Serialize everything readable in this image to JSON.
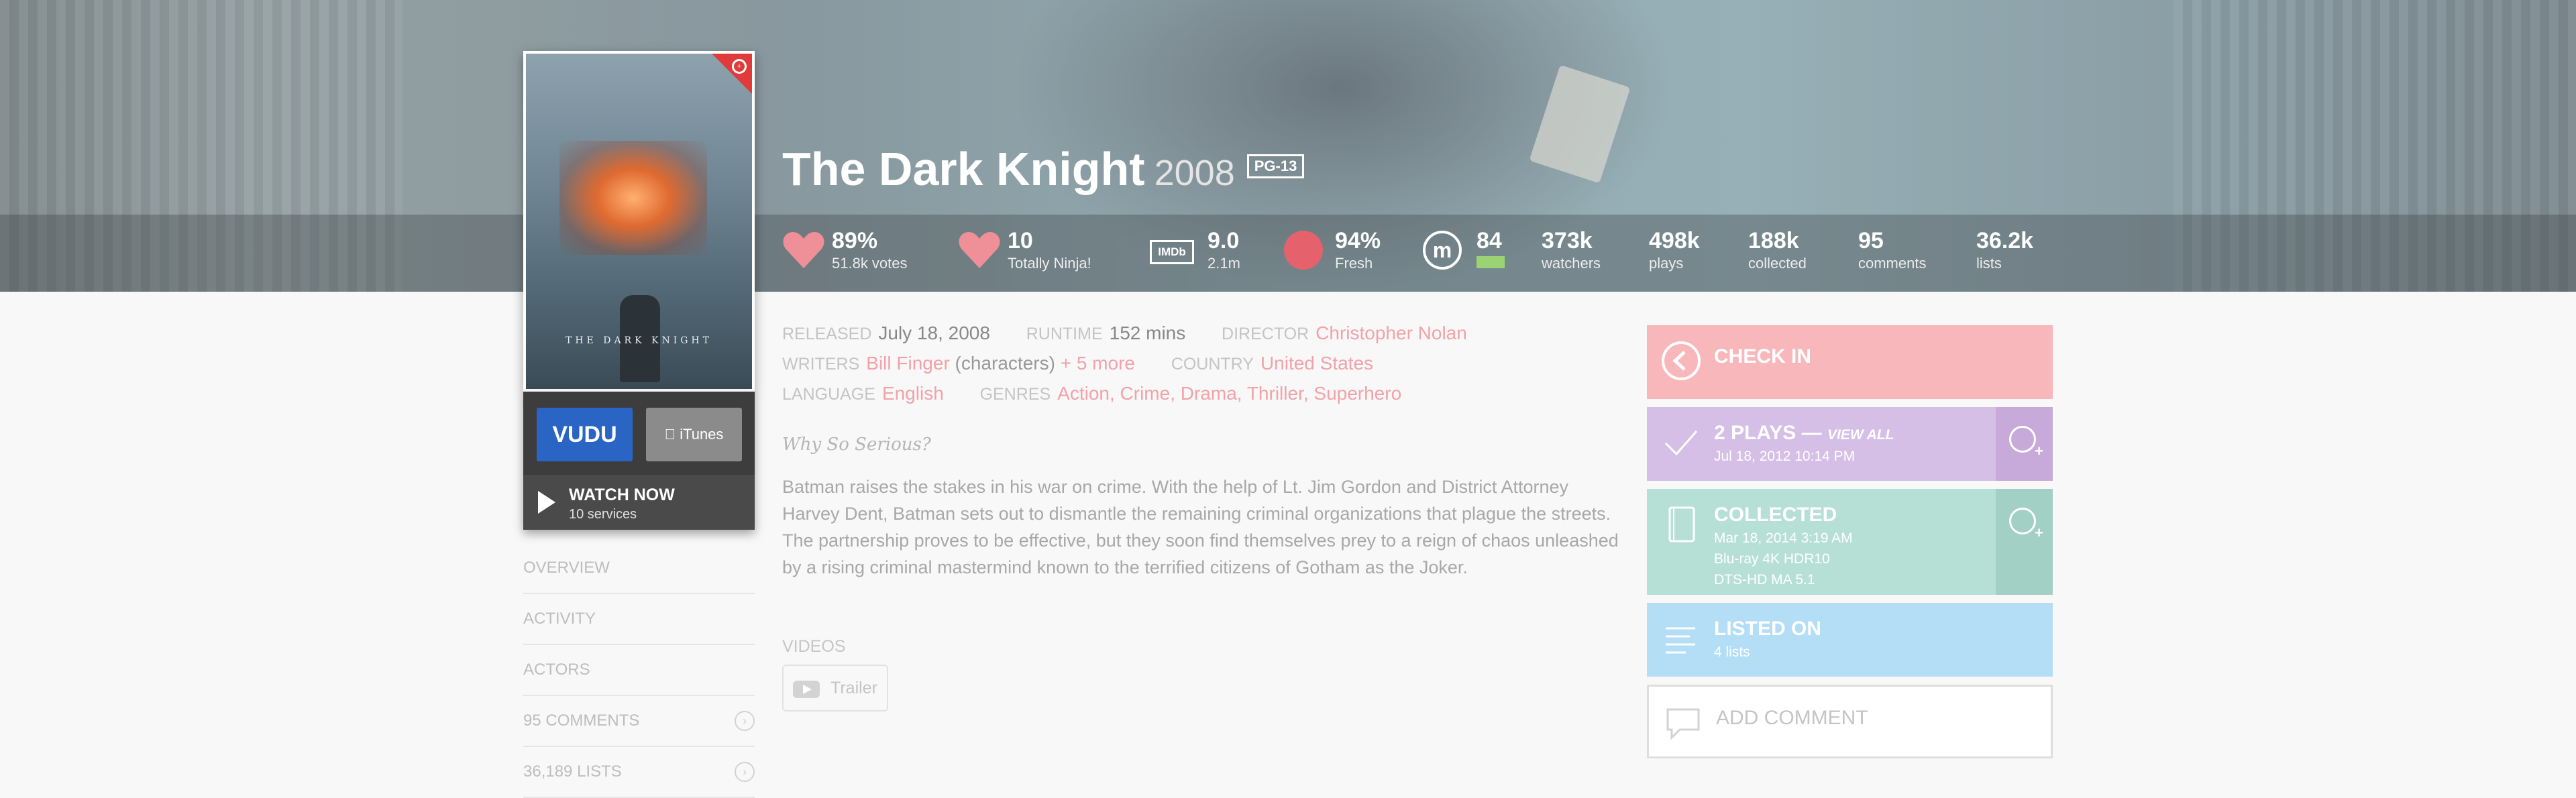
{
  "movie": {
    "title": "The Dark Knight",
    "year": "2008",
    "certification": "PG-13",
    "poster_text": "THE DARK KNIGHT"
  },
  "stats": {
    "trakt_rating": {
      "value": "89%",
      "label": "51.8k votes"
    },
    "user_rating": {
      "value": "10",
      "label": "Totally Ninja!"
    },
    "imdb": {
      "icon": "IMDb",
      "value": "9.0",
      "label": "2.1m"
    },
    "tomatometer": {
      "value": "94%",
      "label": "Fresh"
    },
    "metacritic": {
      "icon": "m",
      "value": "84",
      "color": "#9bd374"
    },
    "watchers": {
      "value": "373k",
      "label": "watchers"
    },
    "plays": {
      "value": "498k",
      "label": "plays"
    },
    "collected": {
      "value": "188k",
      "label": "collected"
    },
    "comments": {
      "value": "95",
      "label": "comments"
    },
    "lists": {
      "value": "36.2k",
      "label": "lists"
    }
  },
  "watch": {
    "vudu_label": "VUDU",
    "itunes_label": "iTunes",
    "watch_now_title": "WATCH NOW",
    "watch_now_sub": "10 services"
  },
  "sidenav": {
    "items": [
      {
        "label": "OVERVIEW"
      },
      {
        "label": "ACTIVITY"
      },
      {
        "label": "ACTORS"
      },
      {
        "label": "95 COMMENTS"
      },
      {
        "label": "36,189 LISTS"
      }
    ]
  },
  "details": {
    "released_key": "RELEASED",
    "released": "July 18, 2008",
    "runtime_key": "RUNTIME",
    "runtime": "152 mins",
    "director_key": "DIRECTOR",
    "director": "Christopher Nolan",
    "writers_key": "WRITERS",
    "writer": "Bill Finger",
    "writer_role": "(characters)",
    "writers_more": "+ 5 more",
    "country_key": "COUNTRY",
    "country": "United States",
    "language_key": "LANGUAGE",
    "language": "English",
    "genres_key": "GENRES",
    "genres": "Action, Crime, Drama, Thriller, Superhero"
  },
  "tagline": "Why So Serious?",
  "overview": "Batman raises the stakes in his war on crime. With the help of Lt. Jim Gordon and District Attorney Harvey Dent, Batman sets out to dismantle the remaining criminal organizations that plague the streets. The partnership proves to be effective, but they soon find themselves prey to a reign of chaos unleashed by a rising criminal mastermind known to the terrified citizens of Gotham as the Joker.",
  "videos": {
    "heading": "VIDEOS",
    "trailer_label": "Trailer"
  },
  "actions": {
    "checkin": "CHECK IN",
    "plays_title": "2 PLAYS —",
    "plays_viewall": "VIEW ALL",
    "plays_date": "Jul 18, 2012 10:14 PM",
    "collected_title": "COLLECTED",
    "collected_date": "Mar 18, 2014 3:19 AM",
    "collected_format": "Blu-ray 4K HDR10",
    "collected_audio": "DTS-HD MA 5.1",
    "listed_title": "LISTED ON",
    "listed_sub": "4 lists",
    "comment": "ADD COMMENT"
  },
  "colors": {
    "checkin": "#f7b7bb",
    "plays": "#d6bfe6",
    "collected": "#b6e0d6",
    "listed": "#b3def5",
    "link": "#f2a2a8"
  }
}
